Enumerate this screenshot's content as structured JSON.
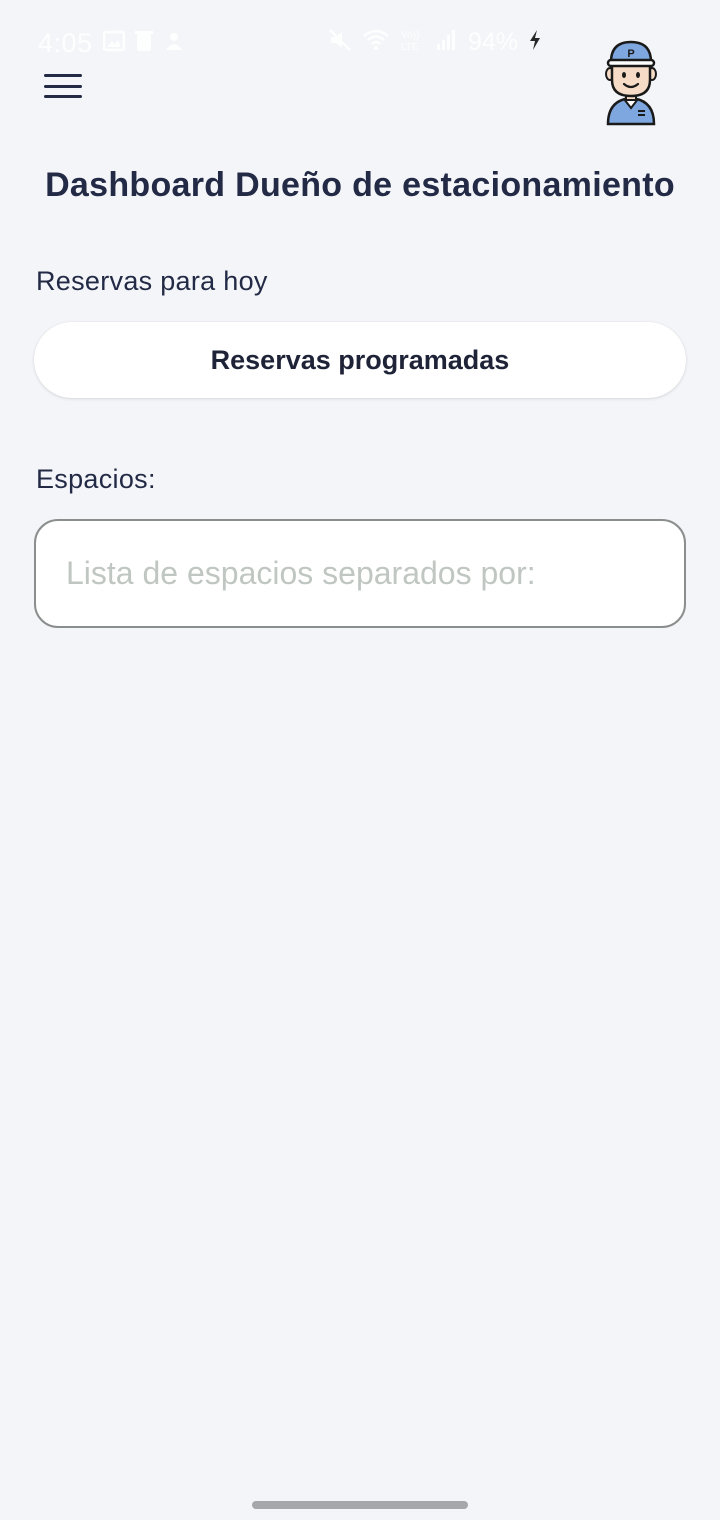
{
  "status_bar": {
    "time": "4:05",
    "battery": "94%",
    "icons": [
      "image-icon",
      "trash-icon",
      "notification-icon",
      "mute-icon",
      "wifi-icon",
      "volte-icon",
      "signal-icon",
      "charging-icon"
    ]
  },
  "header": {
    "menu_icon": "hamburger-menu-icon",
    "avatar_icon": "parking-attendant-avatar",
    "avatar_cap_letter": "P"
  },
  "page": {
    "title": "Dashboard Dueño de estacionamiento"
  },
  "reservas": {
    "label": "Reservas para hoy",
    "button_label": "Reservas programadas"
  },
  "espacios": {
    "label": "Espacios:",
    "input_value": "",
    "input_placeholder": "Lista de espacios separados por:"
  },
  "colors": {
    "background": "#f4f5f9",
    "text": "#232a45",
    "placeholder": "#c0c7c2",
    "avatar_cap": "#7ea6df"
  }
}
